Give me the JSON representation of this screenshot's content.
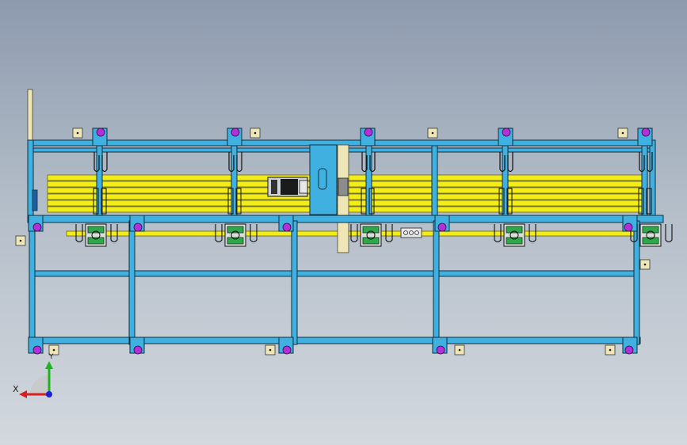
{
  "view": {
    "title": "",
    "background_top": "#8d9aae",
    "background_bottom": "#d3d8de"
  },
  "colors": {
    "frame": "#3fb0e0",
    "frame_edge": "#0f2f40",
    "rod": "#f2ec1b",
    "rod_edge": "#6b6400",
    "bolt": "#b32fd8",
    "cream": "#efe6b8",
    "roller_green": "#2ea84a"
  },
  "triad": {
    "x_label": "X",
    "y_label": "Y",
    "x_color": "#d61f1f",
    "y_color": "#1fb31f",
    "z_color": "#1f1fd6"
  },
  "parts": {
    "motor": "motor-icon",
    "guide_roller": "guide-roller-icon",
    "mount_bolt": "mount-bolt-icon",
    "bracket_plate": "bracket-plate-icon"
  }
}
